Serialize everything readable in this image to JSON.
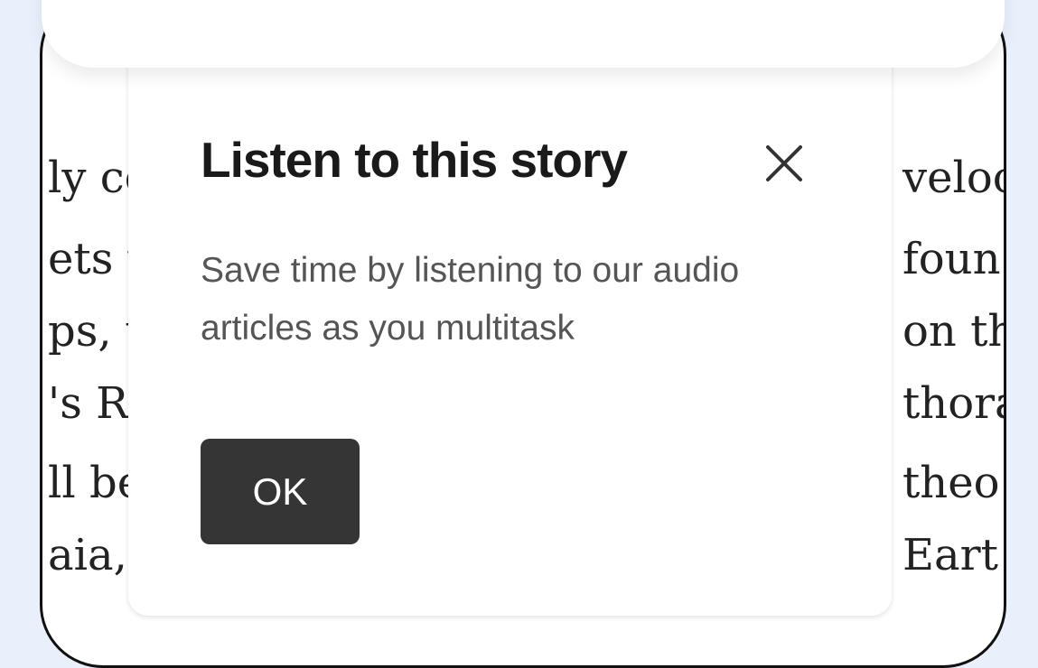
{
  "dialog": {
    "title": "Listen to this story",
    "body": "Save time by listening to our audio articles as you multitask",
    "ok_label": "OK",
    "close_icon": "close-icon"
  },
  "article_background": {
    "left_fragments": [
      "ly co",
      "ets w",
      "ps, w",
      "'s Ro",
      "ll be",
      "aia,"
    ],
    "right_fragments": [
      "veloc",
      "foun",
      "on th",
      "thora",
      "theo",
      "Eart"
    ]
  },
  "colors": {
    "page_background": "#eaf0fb",
    "ok_button": "#353535",
    "title": "#1a1a1a",
    "body_text": "#555555"
  }
}
